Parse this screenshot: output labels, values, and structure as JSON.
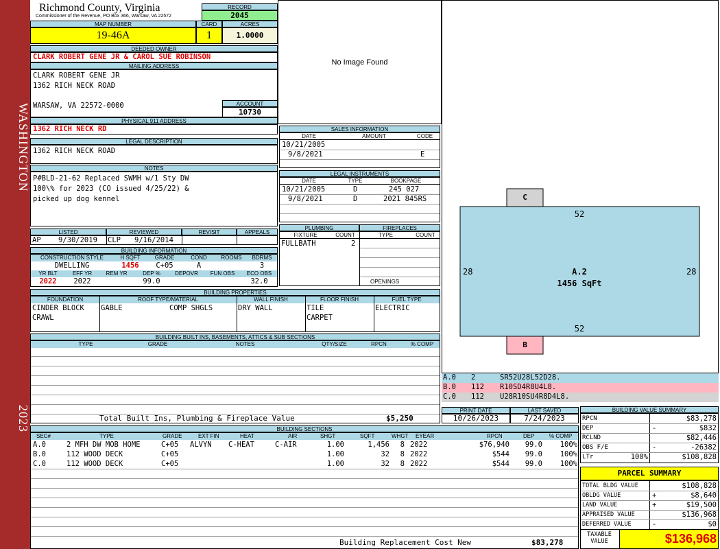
{
  "sidebar": {
    "county": "WASHINGTON",
    "year": "2023"
  },
  "header": {
    "county_title": "Richmond County, Virginia",
    "commissioner": "Commissioner of the Revenue, PO Box 366, Warsaw, VA 22572",
    "record_label": "RECORD",
    "record": "2045",
    "map_label": "MAP NUMBER",
    "map": "19-46A",
    "card_label": "CARD",
    "card": "1",
    "acres_label": "ACRES",
    "acres": "1.0000"
  },
  "owner": {
    "label": "DEEDED OWNER",
    "value": "CLARK ROBERT GENE JR & CAROL SUE ROBINSON"
  },
  "mailing": {
    "label": "MAILING ADDRESS",
    "line1": "CLARK ROBERT GENE JR",
    "line2": "1362 RICH NECK ROAD",
    "line3": "WARSAW, VA 22572-0000"
  },
  "account": {
    "label": "ACCOUNT",
    "value": "10730"
  },
  "physical": {
    "label": "PHYSICAL 911 ADDRESS",
    "value": "1362 RICH NECK RD"
  },
  "legal": {
    "label": "LEGAL DESCRIPTION",
    "value": "1362 RICH NECK ROAD"
  },
  "notes": {
    "label": "NOTES",
    "line1": "P#BLD-21-62 Replaced SWMH w/1 Sty DW",
    "line2": "100\\% for 2023 (CO issued 4/25/22) &",
    "line3": "picked up dog kennel"
  },
  "image": {
    "text": "No Image Found"
  },
  "sales": {
    "label": "SALES INFORMATION",
    "cols": [
      "DATE",
      "AMOUNT",
      "CODE"
    ],
    "rows": [
      {
        "date": "10/21/2005",
        "amount": "",
        "code": ""
      },
      {
        "date": "9/8/2021",
        "amount": "",
        "code": "E"
      }
    ]
  },
  "instruments": {
    "label": "LEGAL INSTRUMENTS",
    "cols": [
      "DATE",
      "TYPE",
      "BOOKPAGE"
    ],
    "rows": [
      {
        "date": "10/21/2005",
        "type": "D",
        "book": "245 027"
      },
      {
        "date": "9/8/2021",
        "type": "D",
        "book": "2021 845RS"
      }
    ]
  },
  "review": {
    "cols": [
      "LISTED",
      "REVIEWED",
      "REVISIT",
      "APPEALS"
    ],
    "listed_by": "AP",
    "listed": "9/30/2019",
    "reviewed_by": "CLP",
    "reviewed": "9/16/2014"
  },
  "plumbing": {
    "label": "PLUMBING",
    "cols": [
      "FIXTURE",
      "COUNT"
    ],
    "fixture": "FULLBATH",
    "count": "2"
  },
  "fireplaces": {
    "label": "FIREPLACES",
    "cols": [
      "TYPE",
      "COUNT"
    ],
    "openings": "OPENINGS"
  },
  "building_info": {
    "label": "BUILDING INFORMATION",
    "cols": [
      "CONSTRUCTION STYLE",
      "H SQFT",
      "GRADE",
      "COND",
      "ROOMS",
      "BDRMS"
    ],
    "style": "DWELLING",
    "hsqft": "1456",
    "grade": "C+05",
    "cond": "A",
    "rooms": "",
    "bdrms": "3",
    "cols2": [
      "YR BLT",
      "EFF YR",
      "REM YR",
      "DEP %",
      "DEPOVR",
      "FUN OBS",
      "ECO OBS"
    ],
    "yrblt": "2022",
    "effyr": "2022",
    "remyr": "",
    "dep": "99.0",
    "depovr": "",
    "funobs": "",
    "ecoobs": "32.0"
  },
  "properties": {
    "label": "BUILDING PROPERTIES",
    "cols": [
      "FOUNDATION",
      "ROOF TYPE/MATERIAL",
      "WALL FINISH",
      "FLOOR FINISH",
      "FUEL TYPE"
    ],
    "foundation1": "CINDER BLOCK",
    "foundation2": "CRAWL",
    "roof_type": "GABLE",
    "roof_mat": "COMP SHGLS",
    "wall": "DRY WALL",
    "floor1": "TILE",
    "floor2": "CARPET",
    "fuel": "ELECTRIC"
  },
  "builtins": {
    "label": "BUILDING BUILT INS, BASEMENTS, ATTICS & SUB SECTIONS",
    "cols": [
      "TYPE",
      "GRADE",
      "NOTES",
      "QTY/SIZE",
      "RPCN",
      "% COMP"
    ],
    "total_label": "Total Built Ins, Plumbing & Fireplace Value",
    "total": "$5,250"
  },
  "sketch": {
    "c": "C",
    "b": "B",
    "top": "52",
    "bottom": "52",
    "left": "28",
    "right": "28",
    "area_label": "A.2",
    "area_sqft": "1456 SqFt"
  },
  "sketch_legend": [
    {
      "id": "A.0",
      "code": "2",
      "path": "SR52U28L52D28.",
      "color": "#add8e6"
    },
    {
      "id": "B.0",
      "code": "112",
      "path": "R10SD4R8U4L8.",
      "color": "#ffb6c1"
    },
    {
      "id": "C.0",
      "code": "112",
      "path": "U28R10SU4R8D4L8.",
      "color": "#d3d3d3"
    }
  ],
  "dates": {
    "print_label": "PRINT DATE",
    "print": "10/26/2023",
    "saved_label": "LAST SAVED",
    "saved": "7/24/2023"
  },
  "sections": {
    "label": "BUILDING SECTIONS",
    "cols": [
      "SEC#",
      "TYPE",
      "GRADE",
      "EXT FIN",
      "HEAT",
      "AIR",
      "SHGT",
      "SQFT",
      "WHGT",
      "EYEAR",
      "RPCN",
      "DEP",
      "% COMP"
    ],
    "rows": [
      {
        "sec": "A.0",
        "type": "2 MFH DW MOB HOME",
        "grade": "C+05",
        "ext": "ALVYN",
        "heat": "C-HEAT",
        "air": "C-AIR",
        "shgt": "1.00",
        "sqft": "1,456",
        "whgt": "8",
        "eyear": "2022",
        "rpcn": "$76,940",
        "dep": "99.0",
        "comp": "100%"
      },
      {
        "sec": "B.0",
        "type": "112 WOOD DECK",
        "grade": "C+05",
        "ext": "",
        "heat": "",
        "air": "",
        "shgt": "1.00",
        "sqft": "32",
        "whgt": "8",
        "eyear": "2022",
        "rpcn": "$544",
        "dep": "99.0",
        "comp": "100%"
      },
      {
        "sec": "C.0",
        "type": "112 WOOD DECK",
        "grade": "C+05",
        "ext": "",
        "heat": "",
        "air": "",
        "shgt": "1.00",
        "sqft": "32",
        "whgt": "8",
        "eyear": "2022",
        "rpcn": "$544",
        "dep": "99.0",
        "comp": "100%"
      }
    ],
    "total_label": "Building Replacement Cost New",
    "total": "$83,278"
  },
  "value_summary": {
    "label": "BUILDING VALUE SUMMARY",
    "rpcn_label": "RPCN",
    "rpcn": "$83,278",
    "dep_label": "DEP",
    "dep_sign": "-",
    "dep": "$832",
    "rclnd_label": "RCLND",
    "rclnd": "$82,446",
    "obs_label": "OBS F/E",
    "obs_sign": "-",
    "obs": "-26382",
    "ltr_label": "LTr",
    "ltr_pct": "100%",
    "ltr": "$108,828"
  },
  "parcel": {
    "label": "PARCEL SUMMARY",
    "bldg_label": "TOTAL BLDG VALUE",
    "bldg": "$108,828",
    "obldg_label": "OBLDG VALUE",
    "obldg_sign": "+",
    "obldg": "$8,640",
    "land_label": "LAND VALUE",
    "land_sign": "+",
    "land": "$19,500",
    "appr_label": "APPRAISED VALUE",
    "appr": "$136,968",
    "def_label": "DEFERRED VALUE",
    "def_sign": "-",
    "def": "$0",
    "taxable_label1": "TAXABLE",
    "taxable_label2": "VALUE",
    "taxable": "$136,968"
  }
}
